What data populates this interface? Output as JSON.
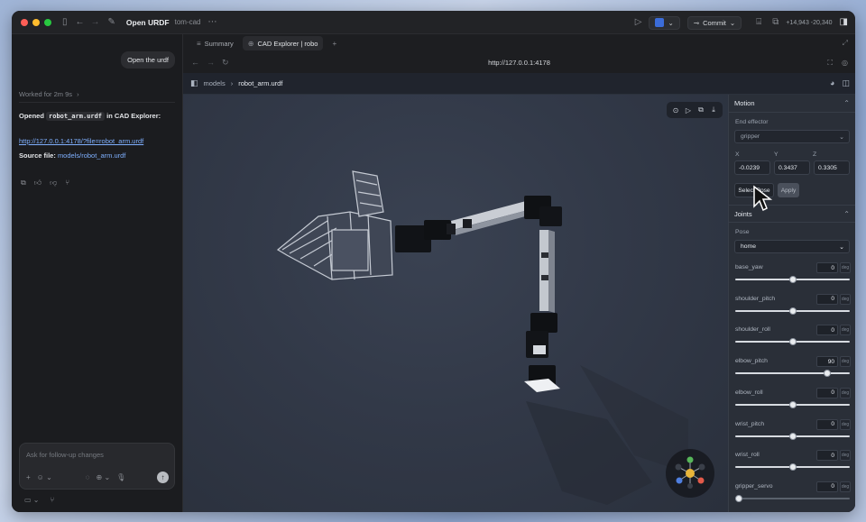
{
  "titlebar": {
    "title": "Open URDF",
    "project": "tom-cad",
    "commit_label": "Commit",
    "diff_added": "+14,943",
    "diff_removed": "-20,340"
  },
  "chat": {
    "user_message": "Open the urdf",
    "worked_for": "Worked for 2m 9s",
    "opened_prefix": "Opened",
    "opened_file": "robot_arm.urdf",
    "opened_suffix": "in CAD Explorer:",
    "explorer_link": "http://127.0.0.1:4178/?file=robot_arm.urdf",
    "source_label": "Source file:",
    "source_path": "models/robot_arm.urdf",
    "composer_placeholder": "Ask for follow-up changes"
  },
  "tabs": [
    {
      "label": "Summary"
    },
    {
      "label": "CAD Explorer | robo"
    }
  ],
  "browser": {
    "url": "http://127.0.0.1:4178"
  },
  "app": {
    "breadcrumb_root": "models",
    "breadcrumb_current": "robot_arm.urdf"
  },
  "motion": {
    "title": "Motion",
    "end_effector_label": "End effector",
    "end_effector_value": "gripper",
    "x_label": "X",
    "y_label": "Y",
    "z_label": "Z",
    "x_value": "-0.0239",
    "y_value": "0.3437",
    "z_value": "0.3305",
    "select_pose_label": "Select Pose",
    "apply_label": "Apply"
  },
  "joints": {
    "title": "Joints",
    "pose_label": "Pose",
    "pose_value": "home",
    "unit": "deg",
    "items": [
      {
        "name": "base_yaw",
        "value": "0",
        "fraction": 0.5
      },
      {
        "name": "shoulder_pitch",
        "value": "0",
        "fraction": 0.5
      },
      {
        "name": "shoulder_roll",
        "value": "0",
        "fraction": 0.5
      },
      {
        "name": "elbow_pitch",
        "value": "90",
        "fraction": 0.82
      },
      {
        "name": "elbow_roll",
        "value": "0",
        "fraction": 0.5
      },
      {
        "name": "wrist_pitch",
        "value": "0",
        "fraction": 0.5
      },
      {
        "name": "wrist_roll",
        "value": "0",
        "fraction": 0.5
      },
      {
        "name": "gripper_servo",
        "value": "0",
        "fraction": 0.0
      }
    ]
  },
  "colors": {
    "accent_link": "#7fb0ff",
    "viewport_bg": "#323948",
    "gizmo_x": "#e25a4a",
    "gizmo_y": "#57b65a",
    "gizmo_z": "#4f7fe0",
    "gizmo_center": "#e9b53a"
  }
}
